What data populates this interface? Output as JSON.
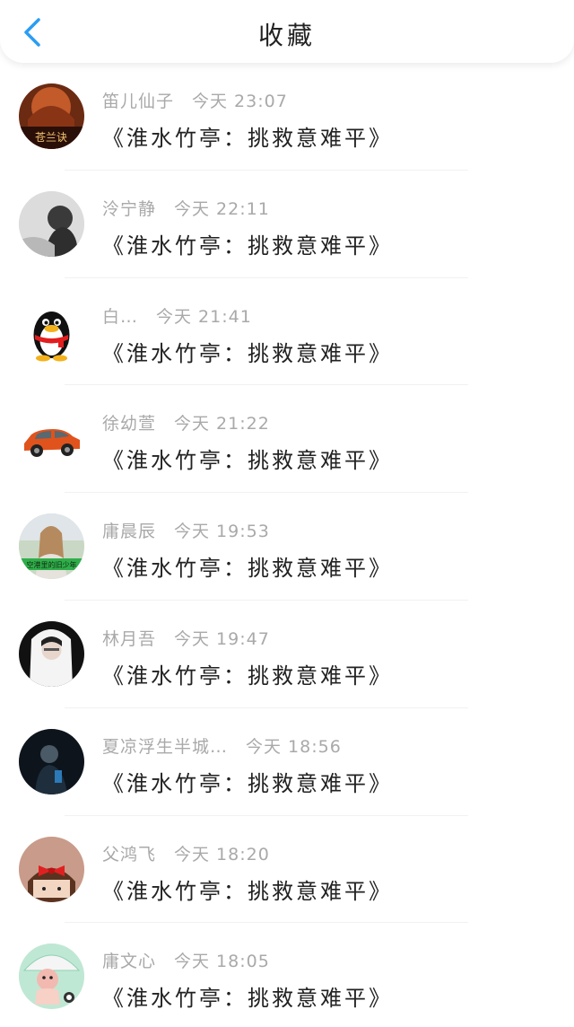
{
  "header": {
    "title": "收藏",
    "back_icon": "chevron-left-icon",
    "accent_color": "#2a9df4"
  },
  "items": [
    {
      "name": "笛儿仙子",
      "time": "今天 23:07",
      "content": "《淮水竹亭：挑救意难平》",
      "avatar": "game-poster-avatar"
    },
    {
      "name": "泠宁静",
      "time": "今天 22:11",
      "content": "《淮水竹亭：挑救意难平》",
      "avatar": "grayscale-girl-avatar"
    },
    {
      "name": "白…",
      "time": "今天 21:41",
      "content": "《淮水竹亭：挑救意难平》",
      "avatar": "penguin-avatar"
    },
    {
      "name": "徐幼萱",
      "time": "今天 21:22",
      "content": "《淮水竹亭：挑救意难平》",
      "avatar": "orange-car-avatar"
    },
    {
      "name": "庸晨辰",
      "time": "今天 19:53",
      "content": "《淮水竹亭：挑救意难平》",
      "avatar": "girl-field-avatar",
      "avatar_text": "空港里的旧少年"
    },
    {
      "name": "林月吾",
      "time": "今天 19:47",
      "content": "《淮水竹亭：挑救意难平》",
      "avatar": "veiled-figure-avatar"
    },
    {
      "name": "夏凉浮生半城…",
      "time": "今天 18:56",
      "content": "《淮水竹亭：挑救意难平》",
      "avatar": "dark-figure-avatar"
    },
    {
      "name": "父鸿飞",
      "time": "今天 18:20",
      "content": "《淮水竹亭：挑救意难平》",
      "avatar": "cartoon-bow-avatar"
    },
    {
      "name": "庸文心",
      "time": "今天 18:05",
      "content": "《淮水竹亭：挑救意难平》",
      "avatar": "cartoon-umbrella-avatar"
    }
  ]
}
